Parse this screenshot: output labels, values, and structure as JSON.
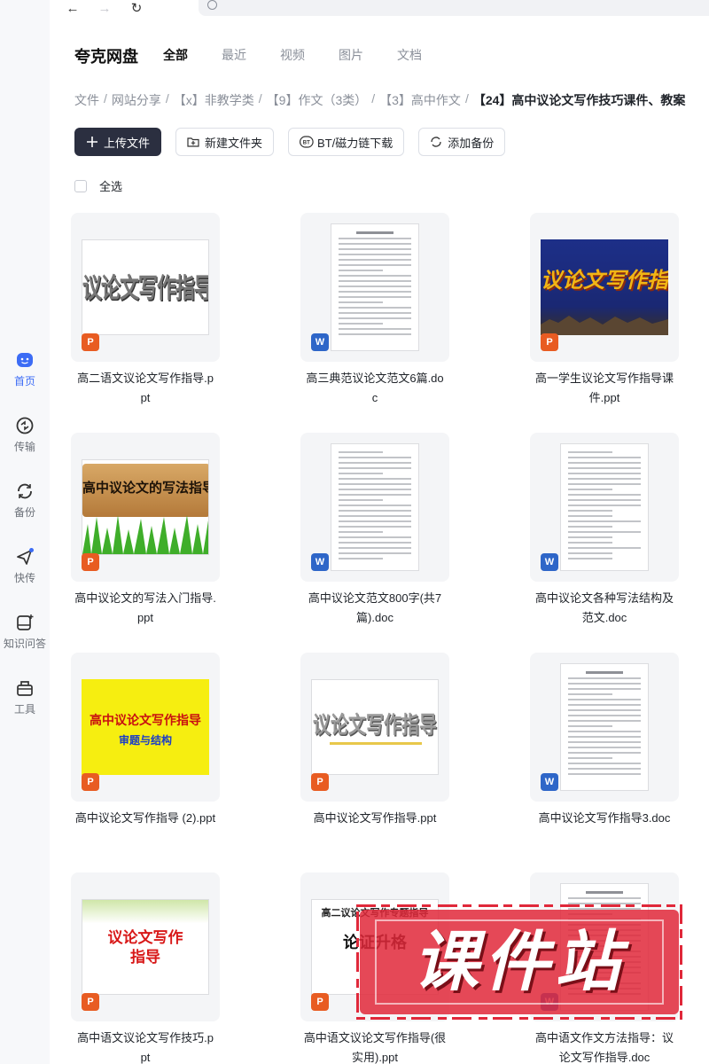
{
  "app": {
    "brand": "夸克网盘"
  },
  "tabs": [
    "全部",
    "最近",
    "视频",
    "图片",
    "文档"
  ],
  "sidebar": [
    {
      "label": "首页",
      "icon": "home-face-icon"
    },
    {
      "label": "传输",
      "icon": "transfer-icon"
    },
    {
      "label": "备份",
      "icon": "backup-icon"
    },
    {
      "label": "快传",
      "icon": "quick-send-icon"
    },
    {
      "label": "知识问答",
      "icon": "knowledge-qa-icon"
    },
    {
      "label": "工具",
      "icon": "toolbox-icon"
    }
  ],
  "breadcrumb": [
    "文件",
    "网站分享",
    "【x】非教学类",
    "【9】作文（3类）",
    "【3】高中作文",
    "【24】高中议论文写作技巧课件、教案"
  ],
  "toolbar": {
    "upload": "上传文件",
    "new_folder": "新建文件夹",
    "bt": "BT/磁力链下载",
    "backup": "添加备份"
  },
  "select_all": "全选",
  "files": [
    {
      "line1": "高二语文议论文写作指导.p",
      "line2": "pt",
      "type": "P",
      "thumb_text": "议论文写作指导()"
    },
    {
      "line1": "高三典范议论文范文6篇.do",
      "line2": "c",
      "type": "W"
    },
    {
      "line1": "高一学生议论文写作指导课",
      "line2": "件.ppt",
      "type": "P",
      "thumb_text": "议论文写作指导"
    },
    {
      "line1": "高中议论文的写法入门指导.",
      "line2": "ppt",
      "type": "P",
      "thumb_text": "高中议论文的写法指导"
    },
    {
      "line1": "高中议论文范文800字(共7",
      "line2": "篇).doc",
      "type": "W"
    },
    {
      "line1": "高中议论文各种写法结构及",
      "line2": "范文.doc",
      "type": "W"
    },
    {
      "line1": "高中议论文写作指导 (2).ppt",
      "line2": "",
      "type": "P",
      "thumb_text": "高中议论文写作指导",
      "thumb_sub": "审题与结构"
    },
    {
      "line1": "高中议论文写作指导.ppt",
      "line2": "",
      "type": "P",
      "thumb_text": "议论文写作指导"
    },
    {
      "line1": "高中议论文写作指导3.doc",
      "line2": "",
      "type": "W"
    },
    {
      "line1": "高中语文议论文写作技巧.p",
      "line2": "pt",
      "type": "P",
      "thumb_text": "议论文写作",
      "thumb_sub": "指导"
    },
    {
      "line1": "高中语文议论文写作指导(很",
      "line2": "实用).ppt",
      "type": "P",
      "thumb_text": "高二议论文写作专题指导",
      "thumb_sub": "论证升格"
    },
    {
      "line1": "高中语文作文方法指导：议",
      "line2": "论文写作指导.doc",
      "type": "W"
    }
  ],
  "watermark": "课件站",
  "colors": {
    "accent": "#3c6cf5",
    "ppt": "#e85c22",
    "doc": "#2e66c8",
    "watermark": "#e0283a"
  }
}
